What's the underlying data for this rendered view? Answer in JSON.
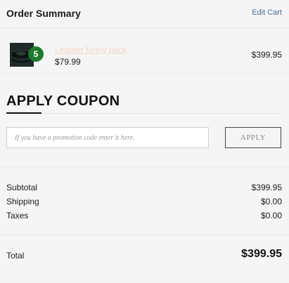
{
  "header": {
    "title": "Order Summary",
    "edit_label": "Edit Cart"
  },
  "item": {
    "image_icon": "fanny-pack-image",
    "quantity": "5",
    "name": "Leather fanny pack",
    "unit_price": "$79.99",
    "line_total": "$399.95"
  },
  "coupon": {
    "title": "APPLY COUPON",
    "placeholder": "If you have a promotion code enter it here.",
    "value": "",
    "apply_label": "APPLY"
  },
  "summary": {
    "subtotal_label": "Subtotal",
    "subtotal_value": "$399.95",
    "shipping_label": "Shipping",
    "shipping_value": "$0.00",
    "taxes_label": "Taxes",
    "taxes_value": "$0.00"
  },
  "total": {
    "label": "Total",
    "value": "$399.95"
  },
  "colors": {
    "accent_link": "#4a6f9c",
    "quantity_badge": "#1d7a2e",
    "item_link": "#f4d6c6"
  }
}
